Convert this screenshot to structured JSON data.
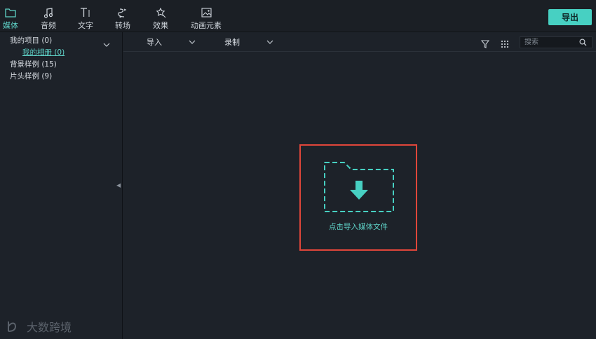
{
  "toolbar": {
    "tabs": [
      {
        "label": "媒体",
        "icon": "folder-icon",
        "active": true
      },
      {
        "label": "音频",
        "icon": "music-note-icon",
        "active": false
      },
      {
        "label": "文字",
        "icon": "text-icon",
        "active": false
      },
      {
        "label": "转场",
        "icon": "transition-icon",
        "active": false
      },
      {
        "label": "效果",
        "icon": "effects-icon",
        "active": false
      },
      {
        "label": "动画元素",
        "icon": "image-icon",
        "active": false
      }
    ],
    "export_label": "导出"
  },
  "sidebar": {
    "items": [
      {
        "label": "我的项目 (0)"
      },
      {
        "label": "我的相册 (0)"
      },
      {
        "label": "背景样例 (15)"
      },
      {
        "label": "片头样例 (9)"
      }
    ]
  },
  "content_toolbar": {
    "import_label": "导入",
    "record_label": "录制",
    "search_placeholder": "搜索"
  },
  "dropzone": {
    "hint": "点击导入媒体文件"
  },
  "watermark": {
    "text": "大数跨境"
  },
  "colors": {
    "accent": "#47d0c2",
    "highlight_border": "#e0463a",
    "background": "#1d2229"
  }
}
